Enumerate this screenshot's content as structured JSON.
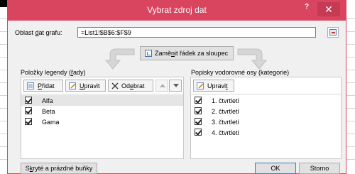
{
  "dialog": {
    "title": "Vybrat zdroj dat",
    "help_label": "?",
    "close_label": "✕"
  },
  "range": {
    "label_pre": "Oblast ",
    "label_u": "d",
    "label_post": "at grafu:",
    "value": "=List1!$B$6:$F$9"
  },
  "switch": {
    "label_pre": "Zamě",
    "label_u": "n",
    "label_post": "it řádek za sloupec"
  },
  "legend": {
    "title_pre": "Položky legendy (",
    "title_u": "ř",
    "title_post": "ady)",
    "add": {
      "pre": "",
      "u": "P",
      "post": "řidat"
    },
    "edit": {
      "pre": "",
      "u": "U",
      "post": "pravit"
    },
    "remove": {
      "pre": "Od",
      "u": "e",
      "post": "brat"
    },
    "items": [
      {
        "label": "Alfa",
        "checked": true
      },
      {
        "label": "Beta",
        "checked": true
      },
      {
        "label": "Gama",
        "checked": true
      }
    ]
  },
  "axis": {
    "title": "Popisky vodorovné osy (kategorie)",
    "edit": {
      "pre": "Upravi",
      "u": "t",
      "post": ""
    },
    "items": [
      {
        "label": "1. čtvrtletí",
        "checked": true
      },
      {
        "label": "2. čtvrtletí",
        "checked": true
      },
      {
        "label": "3. čtvrtletí",
        "checked": true
      },
      {
        "label": "4. čtvrtletí",
        "checked": true
      }
    ]
  },
  "footer": {
    "hidden_pre": "S",
    "hidden_u": "k",
    "hidden_post": "ryté a prázdné buňky",
    "ok": "OK",
    "cancel": "Storno"
  },
  "colors": {
    "titlebar": "#d9445f",
    "dialog_bg": "#f0f0f0",
    "selection": "#e5e5e5"
  }
}
